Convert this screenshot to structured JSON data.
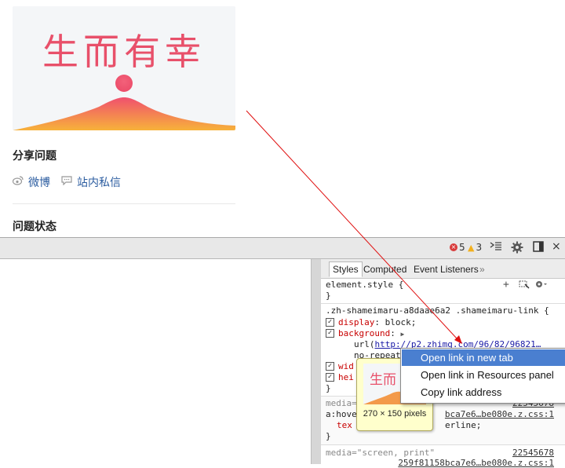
{
  "page": {
    "banner_title": "生而有幸",
    "share_title": "分享问题",
    "share_links": [
      "微博",
      "站内私信"
    ],
    "status_title": "问题状态"
  },
  "devtools": {
    "error_count": "5",
    "warning_count": "3",
    "tabs": [
      "Styles",
      "Computed",
      "Event Listeners"
    ],
    "tabs_more": "»",
    "element_style": {
      "selector": "element.style {",
      "close": "}"
    },
    "rule": {
      "selector": ".zh-shameimaru-a8daae6a2 .shameimaru-link {",
      "display_prop": "display",
      "display_val": "block;",
      "background_prop": "background",
      "url_prefix": "url(",
      "url_text": "http://p2.zhimg.com/96/82/96821…",
      "repeat_text": "no-repeat",
      "wid_prop": "wid",
      "hei_prop": "hei",
      "close": "}"
    },
    "media1": {
      "media_text": "media=",
      "source": "22545678",
      "selector_start": "a:hove",
      "source_file": "bca7e6…be080e.z.css:1",
      "prop_start": "tex",
      "val_end": "erline;",
      "close": "}"
    },
    "media2": {
      "media_text": "media=\"screen, print\"",
      "source": "22545678",
      "source_file": "259f81158bca7e6…be080e.z.css:1"
    }
  },
  "context_menu": {
    "items": [
      "Open link in new tab",
      "Open link in Resources panel",
      "Copy link address"
    ],
    "selected_index": 0
  },
  "preview": {
    "image_text": "生而",
    "caption": "270 × 150 pixels"
  },
  "colors": {
    "banner_text": "#e8506a",
    "banner_gradient_top": "#f0506e",
    "banner_gradient_bottom": "#f7b23a",
    "link_blue": "#2c5da0",
    "menu_highlight": "#4a7fd0",
    "error_red": "#d83b3b",
    "warning_yellow": "#f2b01e"
  }
}
